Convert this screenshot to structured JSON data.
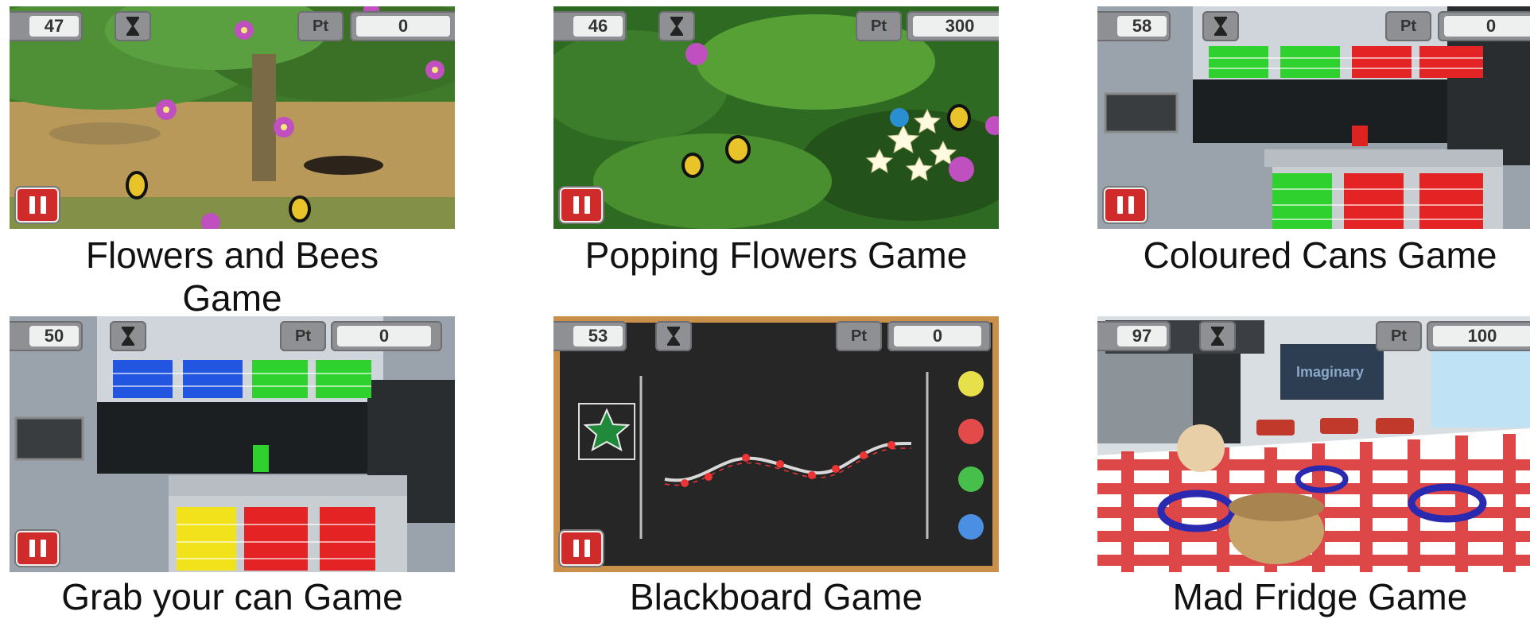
{
  "games": [
    {
      "caption": "Flowers and Bees Game",
      "caption_lines": [
        "Flowers and Bees",
        "Game"
      ],
      "time": "47",
      "points_label": "Pt",
      "points": "0"
    },
    {
      "caption": "Popping Flowers Game",
      "caption_lines": [
        "Popping Flowers Game"
      ],
      "time": "46",
      "points_label": "Pt",
      "points": "300"
    },
    {
      "caption": "Coloured Cans Game",
      "caption_lines": [
        "Coloured Cans Game"
      ],
      "time": "58",
      "points_label": "Pt",
      "points": "0"
    },
    {
      "caption": "Grab your can Game",
      "caption_lines": [
        "Grab your can Game"
      ],
      "time": "50",
      "points_label": "Pt",
      "points": "0"
    },
    {
      "caption": "Blackboard Game",
      "caption_lines": [
        "Blackboard Game"
      ],
      "time": "53",
      "points_label": "Pt",
      "points": "0"
    },
    {
      "caption": "Mad Fridge Game",
      "caption_lines": [
        "Mad Fridge Game"
      ],
      "time": "97",
      "points_label": "Pt",
      "points": "100"
    }
  ],
  "blackboard_sign": "Imaginary",
  "icons": {
    "timer": "hourglass-icon",
    "pause": "pause-icon"
  },
  "colors": {
    "pause_button": "#cf2b2b",
    "hud": "#8f9093"
  }
}
